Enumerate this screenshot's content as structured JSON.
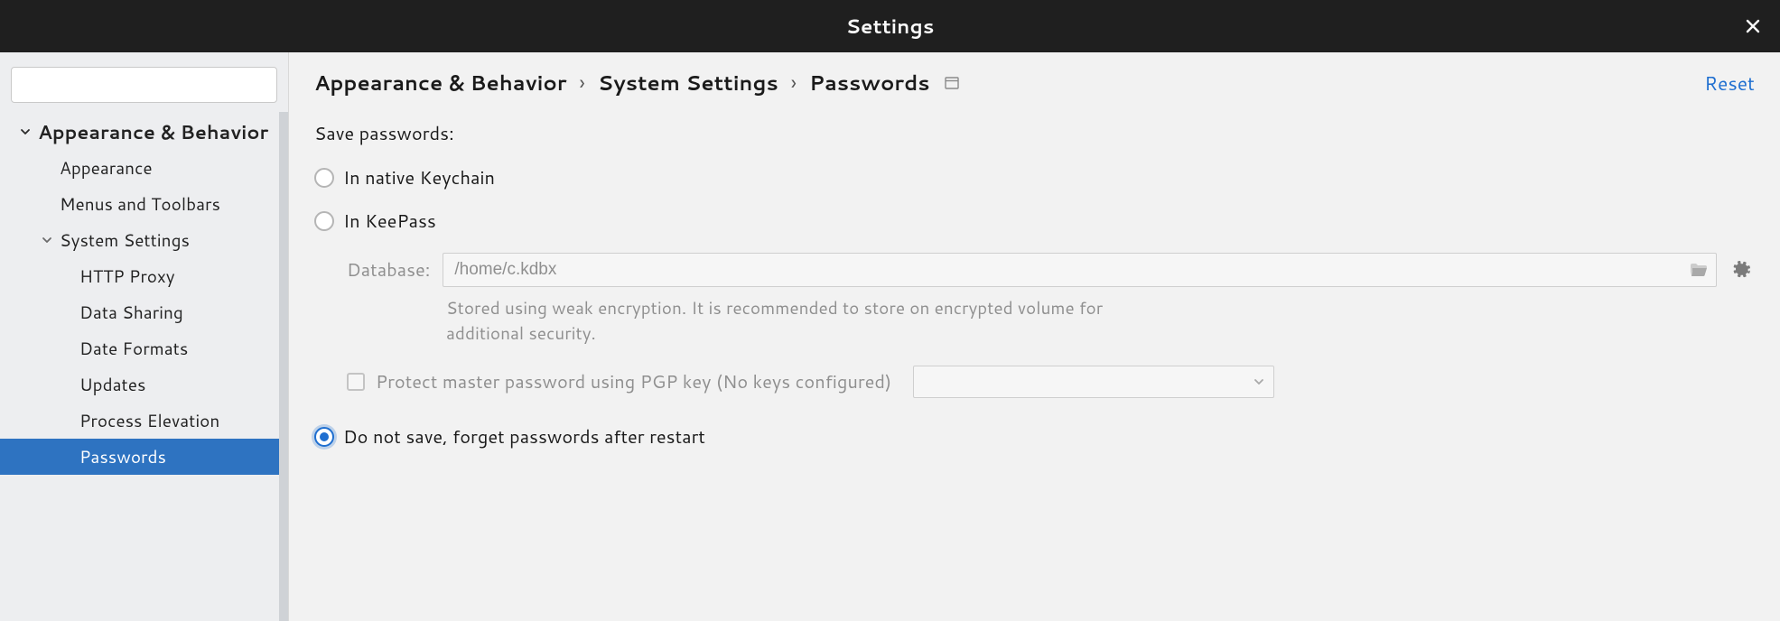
{
  "titlebar": {
    "title": "Settings"
  },
  "sidebar": {
    "items": [
      {
        "label": "Appearance & Behavior"
      },
      {
        "label": "Appearance"
      },
      {
        "label": "Menus and Toolbars"
      },
      {
        "label": "System Settings"
      },
      {
        "label": "HTTP Proxy"
      },
      {
        "label": "Data Sharing"
      },
      {
        "label": "Date Formats"
      },
      {
        "label": "Updates"
      },
      {
        "label": "Process Elevation"
      },
      {
        "label": "Passwords"
      }
    ]
  },
  "breadcrumb": {
    "a": "Appearance & Behavior",
    "b": "System Settings",
    "c": "Passwords",
    "reset": "Reset"
  },
  "content": {
    "save_passwords_label": "Save passwords:",
    "opt_keychain": "In native Keychain",
    "opt_keepass": "In KeePass",
    "db_label": "Database:",
    "db_value": "/home/c.kdbx",
    "db_hint": "Stored using weak encryption. It is recommended to store on encrypted volume for additional security.",
    "protect_label": "Protect master password using PGP key (No keys configured)",
    "opt_donotsave": "Do not save, forget passwords after restart"
  }
}
